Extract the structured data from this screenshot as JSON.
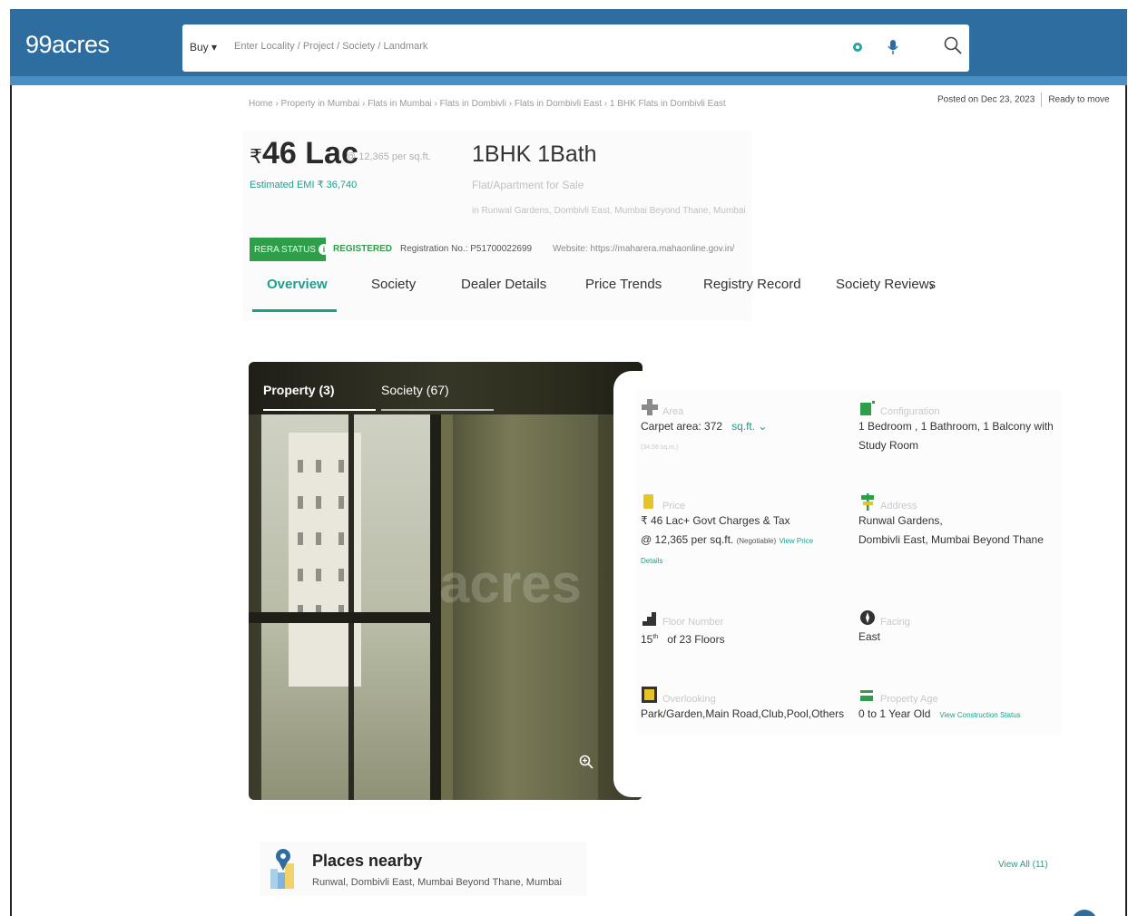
{
  "header": {
    "logo": "99acres",
    "buy_label": "Buy ▾",
    "search_placeholder": "Enter Locality / Project / Society / Landmark"
  },
  "breadcrumb": "Home › Property in Mumbai › Flats in Mumbai › Flats in Dombivli › Flats in Dombivli East › 1 BHK Flats in Dombivli East",
  "posted": {
    "date": "Posted on Dec 23, 2023",
    "status": "Ready to move"
  },
  "listing": {
    "rupee": "₹",
    "price": "46 Lac",
    "price_per_sqft": "@ 12,365 per sq.ft.",
    "emi": "Estimated EMI ₹ 36,740",
    "config": "1BHK 1Bath",
    "type": "Flat/Apartment for Sale",
    "address": "in Runwal Gardens, Dombivli East, Mumbai Beyond Thane, Mumbai"
  },
  "rera": {
    "badge": "RERA STATUS",
    "info_icon": "i",
    "status": "REGISTERED",
    "registration": "Registration No.: P51700022699",
    "website": "Website: https://maharera.mahaonline.gov.in/"
  },
  "tabs": [
    "Overview",
    "Society",
    "Dealer Details",
    "Price Trends",
    "Registry Record",
    "Society Reviews"
  ],
  "tabs_next": "›",
  "gallery": {
    "tab_property": "Property (3)",
    "tab_society": "Society (67)",
    "watermark": "acres"
  },
  "details": {
    "area": {
      "label": "Area",
      "value": "Carpet area: 372",
      "unit": "sq.ft.",
      "sub": "(34.56 sq.m.)"
    },
    "configuration": {
      "label": "Configuration",
      "line1": "1 Bedroom , 1 Bathroom, 1 Balcony with",
      "line2": "Study Room"
    },
    "price": {
      "label": "Price",
      "line1": "₹ 46 Lac+ Govt Charges & Tax",
      "line2": "@ 12,365 per sq.ft.",
      "negotiable": "(Negotiable)",
      "link1": "View Price",
      "link2": "Details"
    },
    "address": {
      "label": "Address",
      "line1": "Runwal Gardens,",
      "line2": "Dombivli East, Mumbai Beyond Thane"
    },
    "floor": {
      "label": "Floor Number",
      "floor": "15",
      "sup": "th",
      "rest": "of 23 Floors"
    },
    "facing": {
      "label": "Facing",
      "value": "East"
    },
    "overlooking": {
      "label": "Overlooking",
      "value": "Park/Garden,Main Road,Club,Pool,Others"
    },
    "age": {
      "label": "Property Age",
      "value": "0 to 1 Year Old",
      "link": "View Construction Status"
    }
  },
  "places": {
    "title": "Places nearby",
    "subtitle": "Runwal, Dombivli East, Mumbai Beyond Thane, Mumbai",
    "view_all": "View All (11)"
  },
  "colors": {
    "header": "#2e6da0",
    "accent": "#1f9e8e",
    "rera_green": "#2e9e4a"
  }
}
